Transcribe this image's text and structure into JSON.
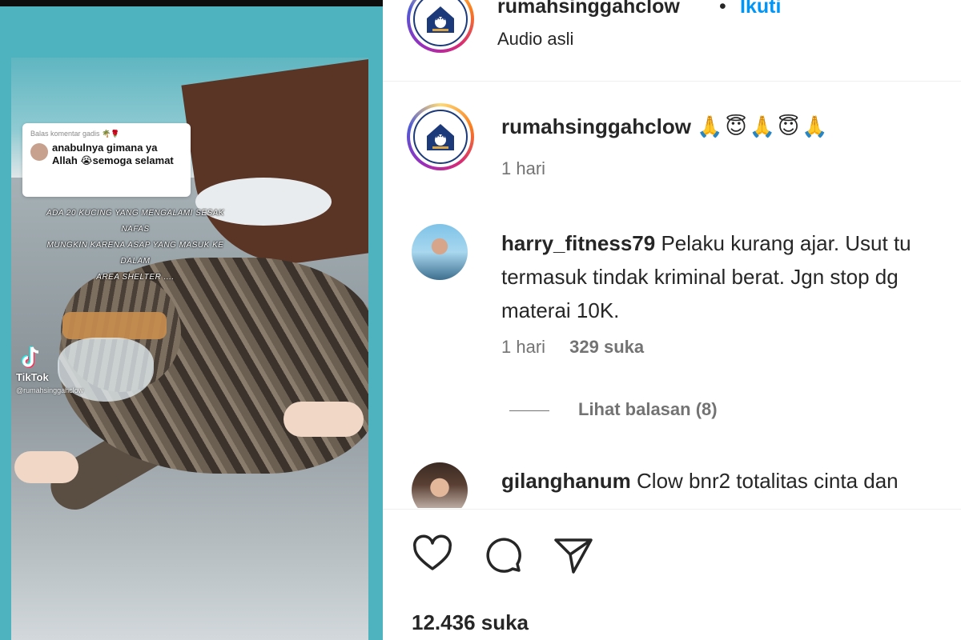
{
  "video": {
    "comment_header": "Balas komentar gadis",
    "comment_text": "anabulnya gimana ya Allah 😭semoga selamat",
    "overlay_line1": "ADA 20 KUCING YANG MENGALAMI SESAK NAFAS",
    "overlay_line2": "MUNGKIN KARENA ASAP YANG MASUK KE DALAM",
    "overlay_line3": "AREA SHELTER ....",
    "tiktok_label": "TikTok",
    "tiktok_user": "@rumahsinggahclow"
  },
  "header": {
    "username": "rumahsinggahclow",
    "dot": "•",
    "follow_label": "Ikuti",
    "audio_label": "Audio asli"
  },
  "caption": {
    "username": "rumahsinggahclow",
    "emojis": "🙏😇🙏😇🙏",
    "time": "1 hari"
  },
  "comments": [
    {
      "username": "harry_fitness79",
      "text": "Pelaku kurang ajar. Usut tu termasuk tindak kriminal berat. Jgn stop dg materai 10K.",
      "time": "1 hari",
      "likes": "329 suka",
      "replies_label": "Lihat balasan (8)"
    },
    {
      "username": "gilanghanum",
      "text": "Clow bnr2 totalitas cinta dan"
    }
  ],
  "footer": {
    "likes_count": "12.436 suka"
  },
  "icons": {
    "like": "heart-icon",
    "comment": "comment-bubble-icon",
    "share": "paper-plane-icon"
  },
  "colors": {
    "follow_blue": "#0095f6",
    "muted_text": "#737373",
    "text": "#262626"
  }
}
